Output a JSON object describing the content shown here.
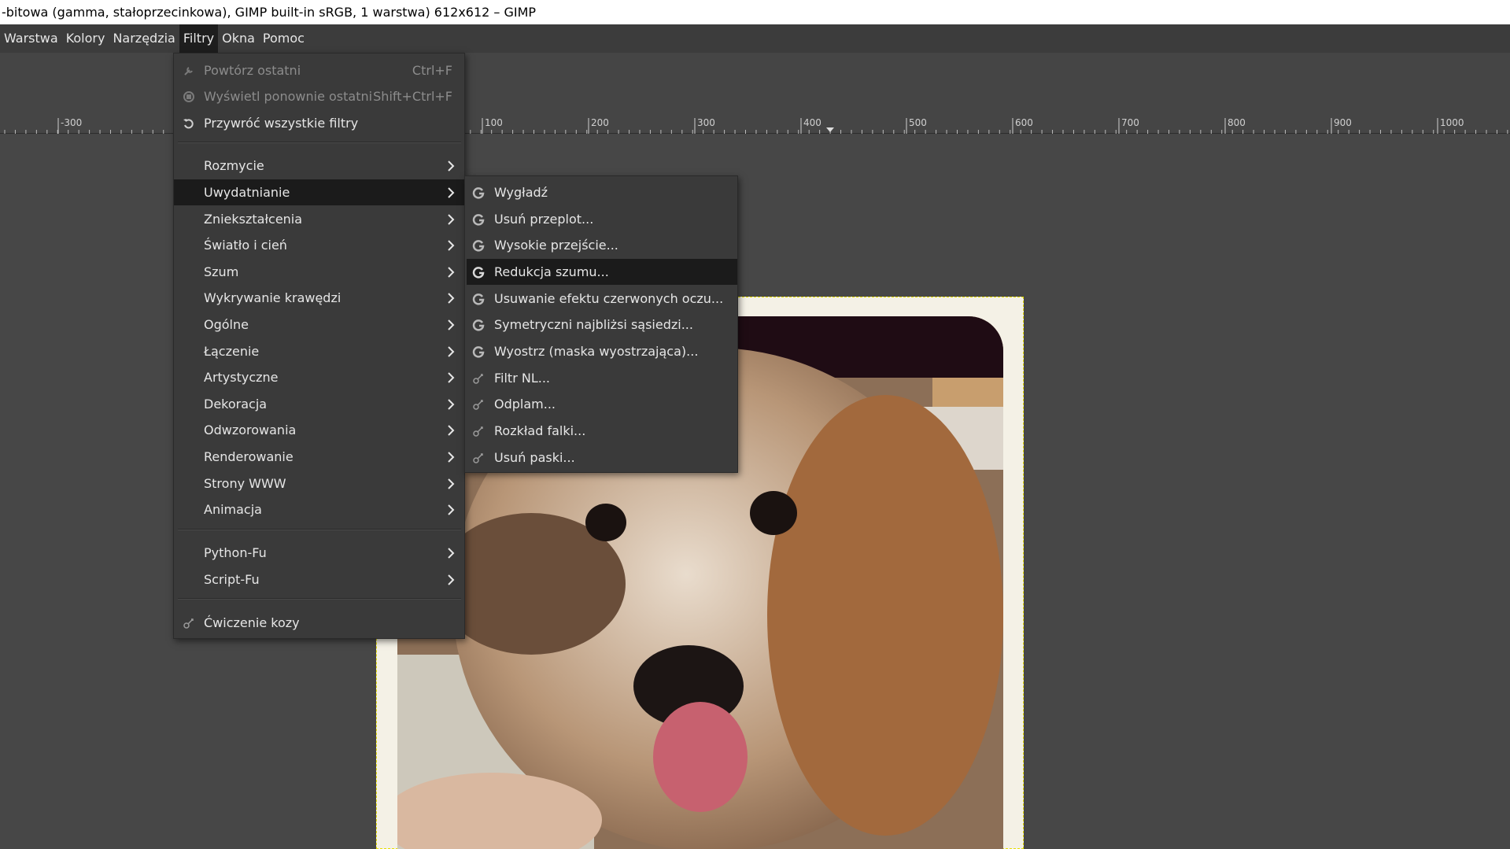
{
  "window": {
    "title": "-bitowa (gamma, stałoprzecinkowa), GIMP built-in sRGB, 1 warstwa) 612x612 – GIMP"
  },
  "menubar": {
    "items": [
      {
        "label": "Warstwa"
      },
      {
        "label": "Kolory"
      },
      {
        "label": "Narzędzia"
      },
      {
        "label": "Filtry",
        "active": true
      },
      {
        "label": "Okna"
      },
      {
        "label": "Pomoc"
      }
    ]
  },
  "ruler": {
    "labels": [
      "-300",
      "100",
      "200",
      "300",
      "400",
      "500",
      "600",
      "700",
      "800",
      "900",
      "1000"
    ]
  },
  "filters_menu": {
    "repeat_last": {
      "label": "Powtórz ostatni",
      "shortcut": "Ctrl+F"
    },
    "reshow_last": {
      "label": "Wyświetl ponownie ostatni",
      "shortcut": "Shift+Ctrl+F"
    },
    "reset_all": {
      "label": "Przywróć wszystkie filtry"
    },
    "categories": [
      {
        "label": "Rozmycie"
      },
      {
        "label": "Uwydatnianie"
      },
      {
        "label": "Zniekształcenia"
      },
      {
        "label": "Światło i cień"
      },
      {
        "label": "Szum"
      },
      {
        "label": "Wykrywanie krawędzi"
      },
      {
        "label": "Ogólne"
      },
      {
        "label": "Łączenie"
      },
      {
        "label": "Artystyczne"
      },
      {
        "label": "Dekoracja"
      },
      {
        "label": "Odwzorowania"
      },
      {
        "label": "Renderowanie"
      },
      {
        "label": "Strony WWW"
      },
      {
        "label": "Animacja"
      }
    ],
    "scripts": [
      {
        "label": "Python-Fu"
      },
      {
        "label": "Script-Fu"
      }
    ],
    "goat": {
      "label": "Ćwiczenie kozy"
    }
  },
  "enhance_submenu": {
    "items": [
      {
        "label": "Wygładź",
        "icon": "gegl-icon"
      },
      {
        "label": "Usuń przeplot...",
        "icon": "gegl-icon"
      },
      {
        "label": "Wysokie przejście...",
        "icon": "gegl-icon"
      },
      {
        "label": "Redukcja szumu...",
        "icon": "gegl-icon"
      },
      {
        "label": "Usuwanie efektu czerwonych oczu...",
        "icon": "gegl-icon"
      },
      {
        "label": "Symetryczni najbliżsi sąsiedzi...",
        "icon": "gegl-icon"
      },
      {
        "label": "Wyostrz (maska wyostrzająca)...",
        "icon": "gegl-icon"
      },
      {
        "label": "Filtr NL...",
        "icon": "plugin-icon"
      },
      {
        "label": "Odplam...",
        "icon": "plugin-icon"
      },
      {
        "label": "Rozkład falki...",
        "icon": "plugin-icon"
      },
      {
        "label": "Usuń paski...",
        "icon": "plugin-icon"
      }
    ]
  },
  "colors": {
    "background": "#454545",
    "menu": "#3a3a3a",
    "highlight": "#1b1b1b",
    "selection_border": "#e8e000"
  }
}
